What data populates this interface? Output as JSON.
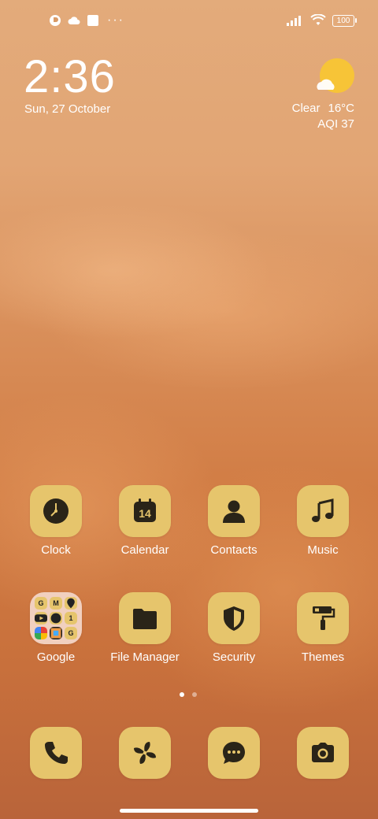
{
  "status_bar": {
    "left_icons": [
      "app-notification-icon",
      "cloud-icon",
      "square-icon"
    ],
    "overflow": "···",
    "battery": "100",
    "right_icons": [
      "signal-icon",
      "wifi-icon",
      "battery-icon"
    ]
  },
  "clock": {
    "time": "2:36",
    "date": "Sun, 27 October"
  },
  "weather": {
    "condition": "Clear",
    "temperature": "16°C",
    "aqi": "AQI 37"
  },
  "apps_row1": [
    {
      "label": "Clock",
      "icon": "clock-icon"
    },
    {
      "label": "Calendar",
      "icon": "calendar-icon",
      "badge": "14"
    },
    {
      "label": "Contacts",
      "icon": "contact-icon"
    },
    {
      "label": "Music",
      "icon": "music-note-icon"
    }
  ],
  "apps_row2": [
    {
      "label": "Google",
      "icon": "folder-icon"
    },
    {
      "label": "File Manager",
      "icon": "folder-file-icon"
    },
    {
      "label": "Security",
      "icon": "shield-icon"
    },
    {
      "label": "Themes",
      "icon": "paint-roller-icon"
    }
  ],
  "google_folder": {
    "mini_apps": [
      "G",
      "M",
      "maps",
      "youtube",
      "assistant",
      "1",
      "photos",
      "tv",
      "G"
    ]
  },
  "dock": [
    {
      "icon": "phone-icon"
    },
    {
      "icon": "pinwheel-icon"
    },
    {
      "icon": "message-icon"
    },
    {
      "icon": "camera-icon"
    }
  ],
  "page_indicator": {
    "pages": 2,
    "active": 1
  },
  "colors": {
    "tile": "#e6c56c",
    "icon": "#2a2418",
    "sun": "#f7c437"
  }
}
